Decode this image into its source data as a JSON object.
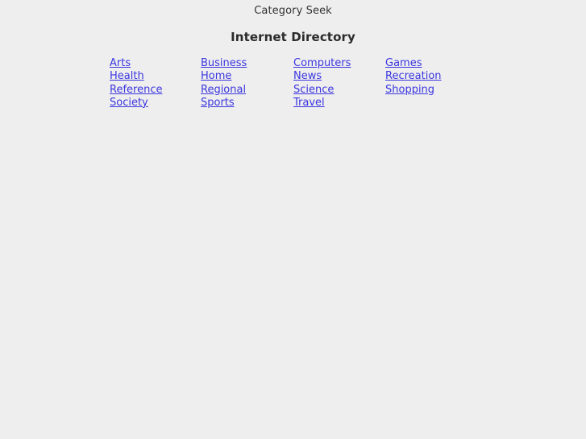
{
  "site": {
    "name": "Category Seek"
  },
  "heading": {
    "title": "Internet Directory"
  },
  "colors": {
    "background": "#eeeeee",
    "link": "#3b36e0",
    "heading_text": "#2b2b2b",
    "site_name_text": "#333333"
  },
  "directory": {
    "columns": [
      {
        "index": 1,
        "items": [
          {
            "label": "Arts"
          },
          {
            "label": "Health"
          },
          {
            "label": "Reference"
          },
          {
            "label": "Society"
          }
        ]
      },
      {
        "index": 2,
        "items": [
          {
            "label": "Business"
          },
          {
            "label": "Home"
          },
          {
            "label": "Regional"
          },
          {
            "label": "Sports"
          }
        ]
      },
      {
        "index": 3,
        "items": [
          {
            "label": "Computers"
          },
          {
            "label": "News"
          },
          {
            "label": "Science"
          },
          {
            "label": "Travel"
          }
        ]
      },
      {
        "index": 4,
        "items": [
          {
            "label": "Games"
          },
          {
            "label": "Recreation"
          },
          {
            "label": "Shopping"
          },
          {
            "label": ""
          }
        ]
      }
    ]
  }
}
